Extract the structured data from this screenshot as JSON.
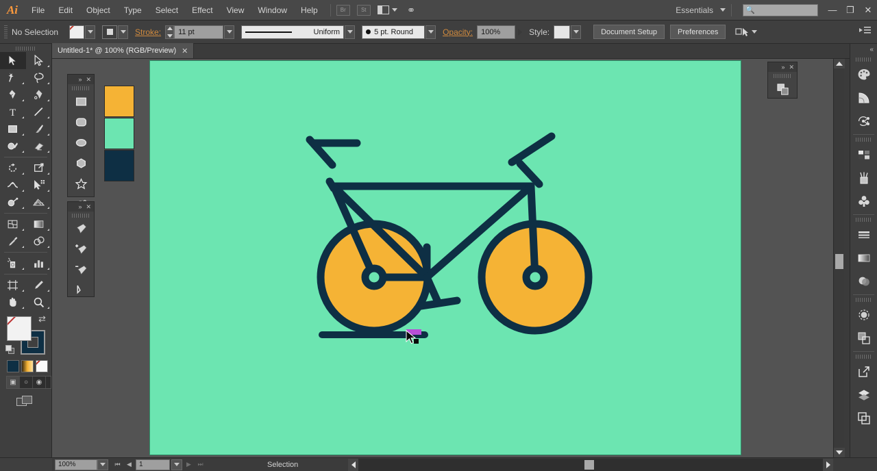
{
  "app": {
    "name": "Adobe Illustrator",
    "logo_text": "Ai"
  },
  "menubar": {
    "items": [
      {
        "label": "File"
      },
      {
        "label": "Edit"
      },
      {
        "label": "Object"
      },
      {
        "label": "Type"
      },
      {
        "label": "Select"
      },
      {
        "label": "Effect"
      },
      {
        "label": "View"
      },
      {
        "label": "Window"
      },
      {
        "label": "Help"
      }
    ],
    "bridge_button": "Br",
    "stock_button": "St",
    "arrange_documents_icon": "layout-icon",
    "workspace_switcher_icon": "workspace-icon",
    "workspace": "Essentials",
    "search_placeholder": "",
    "search_value": "",
    "window_minimize": "—",
    "window_restore": "❐",
    "window_close": "✕"
  },
  "controlbar": {
    "selection_status": "No Selection",
    "fill_swatch": "none-fill-swatch",
    "stroke_swatch": "stroke-swatch",
    "stroke_label": "Stroke:",
    "stroke_weight": "11 pt",
    "stroke_profile": "Uniform",
    "brush_definition": "5 pt. Round",
    "opacity_label": "Opacity:",
    "opacity_value": "100%",
    "style_label": "Style:",
    "document_setup": "Document Setup",
    "preferences": "Preferences",
    "select_similar_icon": "select-similar-icon",
    "panel_menu_icon": "panel-menu-icon"
  },
  "document_tab": {
    "title": "Untitled-1* @ 100% (RGB/Preview)",
    "close": "✕"
  },
  "toolbar": {
    "tools": [
      {
        "name": "selection-tool",
        "active": true
      },
      {
        "name": "direct-selection-tool",
        "active": false
      },
      {
        "name": "magic-wand-tool",
        "active": false
      },
      {
        "name": "lasso-tool",
        "active": false
      },
      {
        "name": "pen-tool",
        "active": false
      },
      {
        "name": "curvature-tool",
        "active": false
      },
      {
        "name": "type-tool",
        "active": false
      },
      {
        "name": "line-segment-tool",
        "active": false
      },
      {
        "name": "rectangle-tool",
        "active": false
      },
      {
        "name": "paintbrush-tool",
        "active": false
      },
      {
        "name": "shaper-tool",
        "active": false
      },
      {
        "name": "eraser-tool",
        "active": false
      },
      {
        "name": "rotate-tool",
        "active": false
      },
      {
        "name": "scale-tool",
        "active": false
      },
      {
        "name": "width-tool",
        "active": false
      },
      {
        "name": "free-transform-tool",
        "active": false
      },
      {
        "name": "shape-builder-tool",
        "active": false
      },
      {
        "name": "perspective-grid-tool",
        "active": false
      },
      {
        "name": "mesh-tool",
        "active": false
      },
      {
        "name": "gradient-tool",
        "active": false
      },
      {
        "name": "eyedropper-tool",
        "active": false
      },
      {
        "name": "blend-tool",
        "active": false
      },
      {
        "name": "symbol-sprayer-tool",
        "active": false
      },
      {
        "name": "column-graph-tool",
        "active": false
      },
      {
        "name": "artboard-tool",
        "active": false
      },
      {
        "name": "slice-tool",
        "active": false
      },
      {
        "name": "hand-tool",
        "active": false
      },
      {
        "name": "zoom-tool",
        "active": false
      }
    ],
    "fill_state": "none",
    "stroke_color": "#0E2F44",
    "swap_icon": "swap-fill-stroke-icon",
    "default_icon": "default-fill-stroke-icon",
    "color_modes": [
      "color-mode",
      "gradient-mode",
      "none-mode"
    ],
    "draw_modes": [
      "draw-normal",
      "draw-behind",
      "draw-inside"
    ],
    "screen_mode": "change-screen-mode-icon"
  },
  "shape_panel": {
    "collapse": "»",
    "close": "✕",
    "tools": [
      {
        "name": "rectangle-tool"
      },
      {
        "name": "rounded-rectangle-tool"
      },
      {
        "name": "ellipse-tool"
      },
      {
        "name": "polygon-tool"
      },
      {
        "name": "star-tool"
      },
      {
        "name": "flare-tool"
      }
    ]
  },
  "pen_panel": {
    "collapse": "»",
    "close": "✕",
    "tools": [
      {
        "name": "pen-tool"
      },
      {
        "name": "add-anchor-point-tool"
      },
      {
        "name": "delete-anchor-point-tool"
      },
      {
        "name": "anchor-point-tool"
      }
    ]
  },
  "pathfinder_panel": {
    "collapse": "»",
    "close": "✕",
    "tool": "shape-builder-icon"
  },
  "swatches": [
    {
      "name": "orange-swatch",
      "color": "#F5B335"
    },
    {
      "name": "mint-swatch",
      "color": "#6CE5B1"
    },
    {
      "name": "navy-swatch",
      "color": "#0E2F44"
    }
  ],
  "canvas": {
    "artboard_color": "#6CE5B1",
    "artwork": {
      "name": "bicycle-illustration",
      "stroke_color": "#0E2F44",
      "wheel_fill": "#F5B335",
      "selection_highlight": "#B84FD8"
    },
    "cursor": "selection-arrow-cursor"
  },
  "right_dock": {
    "collapse": "«",
    "items": [
      {
        "name": "color-panel-icon"
      },
      {
        "name": "color-guide-panel-icon"
      },
      {
        "name": "recolor-artwork-icon"
      },
      {
        "name": "swatches-panel-icon"
      },
      {
        "name": "brushes-panel-icon"
      },
      {
        "name": "symbols-panel-icon"
      },
      {
        "name": "stroke-panel-icon"
      },
      {
        "name": "gradient-panel-icon"
      },
      {
        "name": "transparency-panel-icon"
      },
      {
        "name": "appearance-panel-icon"
      },
      {
        "name": "pathfinder-panel-icon"
      },
      {
        "name": "asset-export-panel-icon"
      },
      {
        "name": "layers-panel-icon"
      },
      {
        "name": "artboards-panel-icon"
      }
    ]
  },
  "statusbar": {
    "zoom": "100%",
    "artboard_number": "1",
    "status_text": "Selection",
    "first_icon": "⏮",
    "prev_icon": "◀",
    "next_icon": "▶",
    "last_icon": "⏭"
  }
}
